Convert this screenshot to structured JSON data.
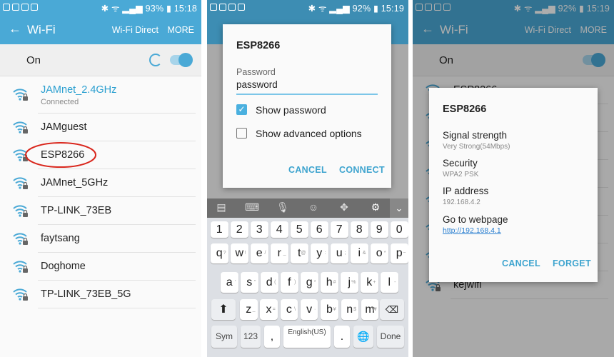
{
  "colors": {
    "accent": "#4aa9d6",
    "annotation": "#d9261c"
  },
  "panels": [
    {
      "status": {
        "battery": "93%",
        "time": "15:18"
      },
      "appbar": {
        "title": "Wi-Fi",
        "direct": "Wi-Fi Direct",
        "more": "MORE"
      },
      "on_label": "On",
      "networks": [
        {
          "name": "JAMnet_2.4GHz",
          "sub": "Connected"
        },
        {
          "name": "JAMguest"
        },
        {
          "name": "ESP8266",
          "highlighted": true
        },
        {
          "name": "JAMnet_5GHz"
        },
        {
          "name": "TP-LINK_73EB"
        },
        {
          "name": "faytsang"
        },
        {
          "name": "Doghome"
        },
        {
          "name": "TP-LINK_73EB_5G"
        }
      ]
    },
    {
      "status": {
        "battery": "92%",
        "time": "15:19"
      },
      "dialog": {
        "title": "ESP8266",
        "password_label": "Password",
        "password_value": "password",
        "show_password": "Show password",
        "show_password_checked": true,
        "advanced": "Show advanced options",
        "advanced_checked": false,
        "cancel": "CANCEL",
        "connect": "CONNECT"
      },
      "keyboard": {
        "rows": [
          [
            [
              "1",
              ""
            ],
            [
              "2",
              ""
            ],
            [
              "3",
              ""
            ],
            [
              "4",
              ""
            ],
            [
              "5",
              ""
            ],
            [
              "6",
              ""
            ],
            [
              "7",
              ""
            ],
            [
              "8",
              ""
            ],
            [
              "9",
              ""
            ],
            [
              "0",
              ""
            ]
          ],
          [
            [
              "q",
              "?"
            ],
            [
              "w",
              "!"
            ],
            [
              "e",
              "/"
            ],
            [
              "r",
              "_"
            ],
            [
              "t",
              "@"
            ],
            [
              "y",
              ":"
            ],
            [
              "u",
              ";"
            ],
            [
              "i",
              "&"
            ],
            [
              "o",
              "*"
            ],
            [
              "p",
              "~"
            ]
          ],
          [
            [
              "a",
              "'"
            ],
            [
              "s",
              "\""
            ],
            [
              "d",
              "("
            ],
            [
              "f",
              ")"
            ],
            [
              "g",
              "*"
            ],
            [
              "h",
              "#"
            ],
            [
              "j",
              "%"
            ],
            [
              "k",
              "+"
            ],
            [
              "l",
              "-"
            ]
          ],
          [
            [
              "z",
              "_"
            ],
            [
              "x",
              "="
            ],
            [
              "c",
              "\\"
            ],
            [
              "v",
              "·"
            ],
            [
              "b",
              "¥"
            ],
            [
              "n",
              "$"
            ],
            [
              "m",
              "₩"
            ]
          ]
        ],
        "sym": "Sym",
        "num": "123",
        "comma": ",",
        "space": "English(US)",
        "period": ".",
        "done": "Done"
      }
    },
    {
      "status": {
        "battery": "92%",
        "time": "15:19"
      },
      "appbar": {
        "title": "Wi-Fi",
        "direct": "Wi-Fi Direct",
        "more": "MORE"
      },
      "on_label": "On",
      "networks": [
        {
          "name": "ESP8266"
        },
        {
          "name": ""
        },
        {
          "name": ""
        },
        {
          "name": ""
        },
        {
          "name": ""
        },
        {
          "name": ""
        },
        {
          "name": ""
        },
        {
          "name": "kejwifi"
        }
      ],
      "dialog": {
        "title": "ESP8266",
        "fields": [
          {
            "label": "Signal strength",
            "value": "Very Strong(54Mbps)"
          },
          {
            "label": "Security",
            "value": "WPA2 PSK"
          },
          {
            "label": "IP address",
            "value": "192.168.4.2"
          }
        ],
        "webpage_label": "Go to webpage",
        "webpage_link": "http://192.168.4.1",
        "cancel": "CANCEL",
        "forget": "FORGET"
      }
    }
  ]
}
